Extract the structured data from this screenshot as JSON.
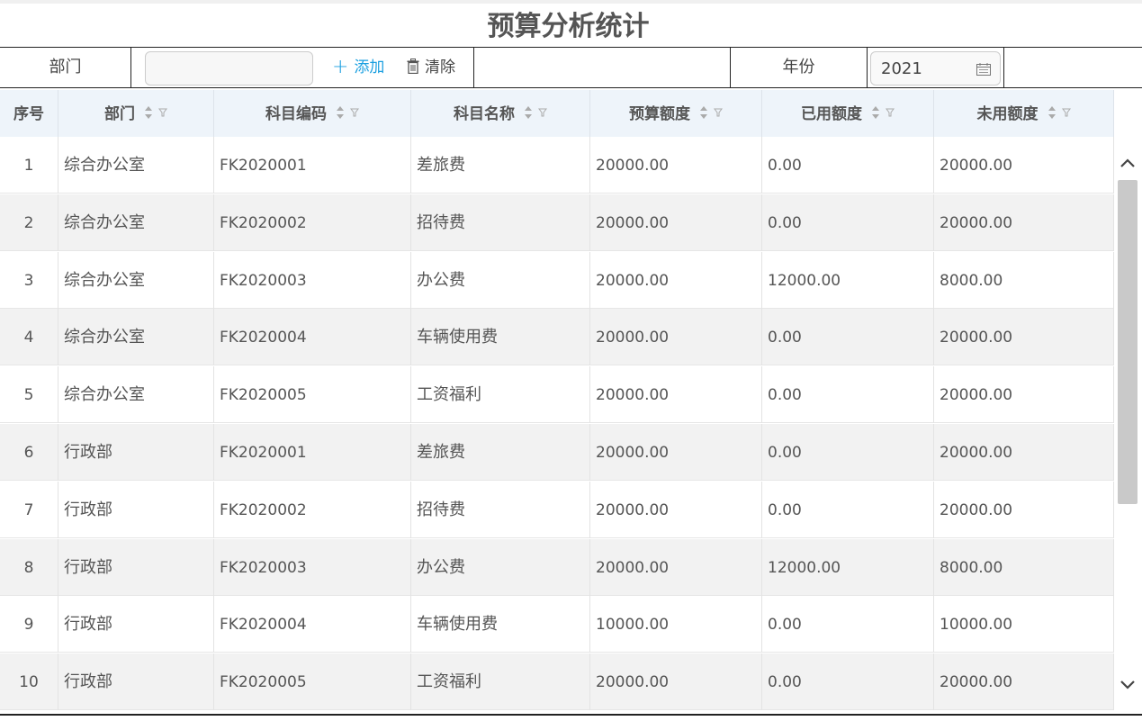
{
  "page": {
    "title": "预算分析统计"
  },
  "filters": {
    "dept_label": "部门",
    "dept_value": "",
    "add_label": "添加",
    "clear_label": "清除",
    "year_label": "年份",
    "year_value": "2021"
  },
  "table": {
    "columns": [
      "序号",
      "部门",
      "科目编码",
      "科目名称",
      "预算额度",
      "已用额度",
      "未用额度"
    ],
    "rows": [
      [
        "1",
        "综合办公室",
        "FK2020001",
        "差旅费",
        "20000.00",
        "0.00",
        "20000.00"
      ],
      [
        "2",
        "综合办公室",
        "FK2020002",
        "招待费",
        "20000.00",
        "0.00",
        "20000.00"
      ],
      [
        "3",
        "综合办公室",
        "FK2020003",
        "办公费",
        "20000.00",
        "12000.00",
        "8000.00"
      ],
      [
        "4",
        "综合办公室",
        "FK2020004",
        "车辆使用费",
        "20000.00",
        "0.00",
        "20000.00"
      ],
      [
        "5",
        "综合办公室",
        "FK2020005",
        "工资福利",
        "20000.00",
        "0.00",
        "20000.00"
      ],
      [
        "6",
        "行政部",
        "FK2020001",
        "差旅费",
        "20000.00",
        "0.00",
        "20000.00"
      ],
      [
        "7",
        "行政部",
        "FK2020002",
        "招待费",
        "20000.00",
        "0.00",
        "20000.00"
      ],
      [
        "8",
        "行政部",
        "FK2020003",
        "办公费",
        "20000.00",
        "12000.00",
        "8000.00"
      ],
      [
        "9",
        "行政部",
        "FK2020004",
        "车辆使用费",
        "10000.00",
        "0.00",
        "10000.00"
      ],
      [
        "10",
        "行政部",
        "FK2020005",
        "工资福利",
        "20000.00",
        "0.00",
        "20000.00"
      ]
    ]
  },
  "colors": {
    "accent": "#1a9fe0",
    "header_bg": "#eef4fa",
    "stripe": "#f2f2f2"
  },
  "icons": {
    "add": "plus-icon",
    "clear": "trash-icon",
    "date": "calendar-icon",
    "sort": "sort-icon",
    "filter": "filter-icon"
  }
}
